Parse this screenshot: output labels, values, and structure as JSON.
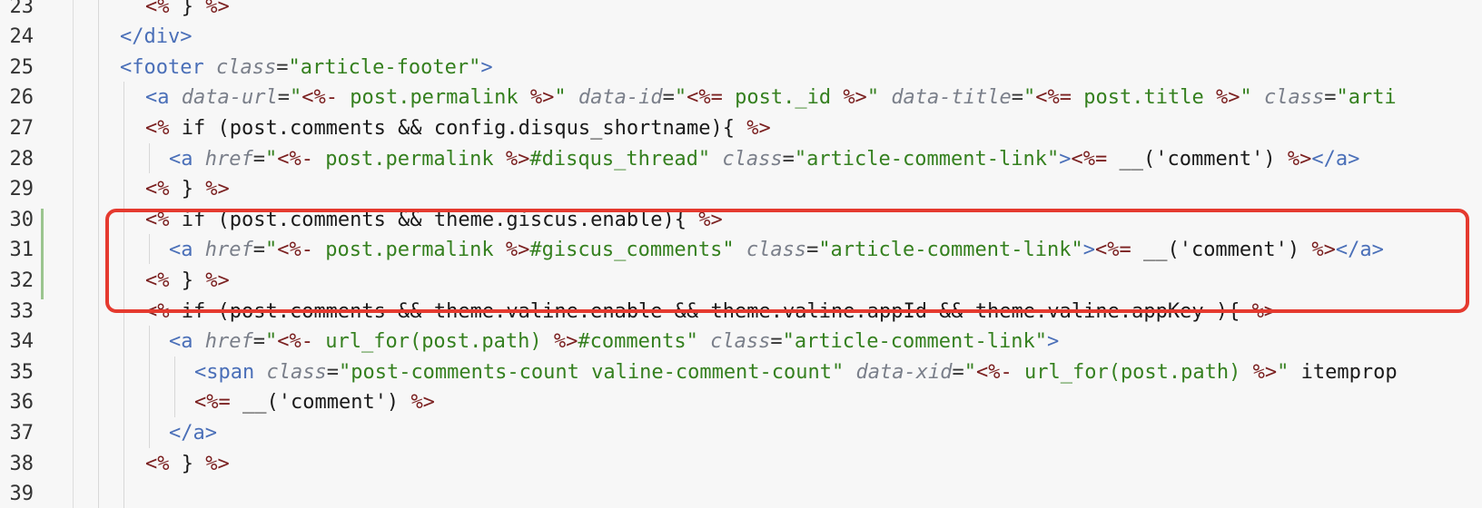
{
  "highlight_color": "#e53a2f",
  "vcs_added_color": "#9bc58f",
  "lines": [
    {
      "n": "23",
      "text": "<% } %>"
    },
    {
      "n": "24",
      "text": "</div>"
    },
    {
      "n": "25",
      "text": "<footer class=\"article-footer\">"
    },
    {
      "n": "26",
      "text": "<a data-url=\"<%- post.permalink %>\" data-id=\"<%= post._id %>\" data-title=\"<%= post.title %>\" class=\"arti"
    },
    {
      "n": "27",
      "text": "<% if (post.comments && config.disqus_shortname){ %>"
    },
    {
      "n": "28",
      "text": "<a href=\"<%- post.permalink %>#disqus_thread\" class=\"article-comment-link\"><%= __('comment') %></a>"
    },
    {
      "n": "29",
      "text": "<% } %>"
    },
    {
      "n": "30",
      "text": "<% if (post.comments && theme.giscus.enable){ %>"
    },
    {
      "n": "31",
      "text": "<a href=\"<%- post.permalink %>#giscus_comments\" class=\"article-comment-link\"><%= __('comment') %></a>"
    },
    {
      "n": "32",
      "text": "<% } %>"
    },
    {
      "n": "33",
      "text": "<% if (post.comments && theme.valine.enable && theme.valine.appId && theme.valine.appKey ){ %>"
    },
    {
      "n": "34",
      "text": "<a href=\"<%- url_for(post.path) %>#comments\" class=\"article-comment-link\">"
    },
    {
      "n": "35",
      "text": "<span class=\"post-comments-count valine-comment-count\" data-xid=\"<%- url_for(post.path) %>\" itemprop"
    },
    {
      "n": "36",
      "text": "<%= __('comment') %>"
    },
    {
      "n": "37",
      "text": "</a>"
    },
    {
      "n": "38",
      "text": "<% } %>"
    },
    {
      "n": "39",
      "text": ""
    }
  ]
}
